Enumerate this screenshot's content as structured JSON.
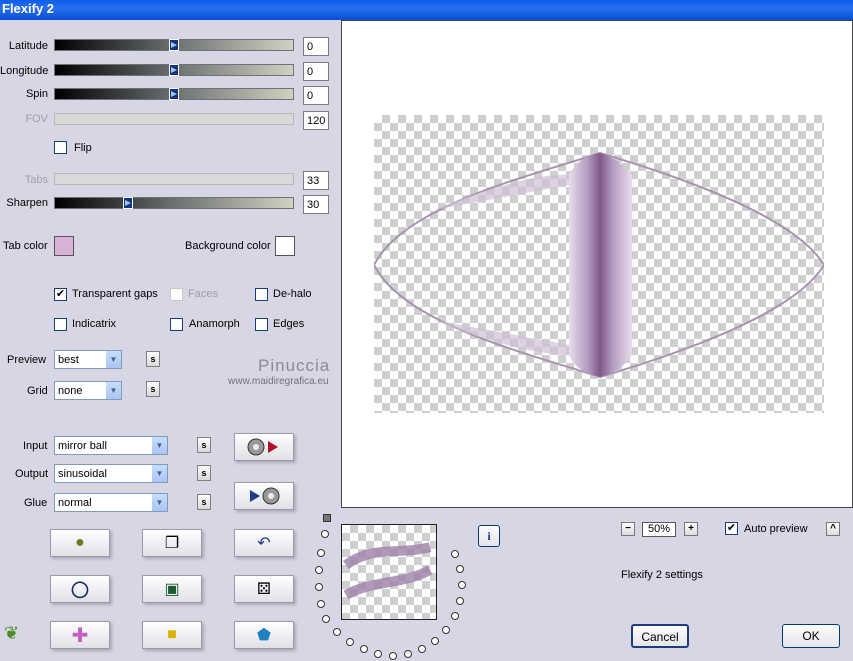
{
  "window": {
    "title": "Flexify 2"
  },
  "sliders": {
    "latitude": {
      "label": "Latitude",
      "value": "0"
    },
    "longitude": {
      "label": "Longitude",
      "value": "0"
    },
    "spin": {
      "label": "Spin",
      "value": "0"
    },
    "fov": {
      "label": "FOV",
      "value": "120"
    },
    "tabs": {
      "label": "Tabs",
      "value": "33"
    },
    "sharpen": {
      "label": "Sharpen",
      "value": "30"
    }
  },
  "flip": {
    "label": "Flip",
    "checked": false
  },
  "colors": {
    "tab_color_label": "Tab color",
    "tab_color": "#d8b0d8",
    "background_color_label": "Background color",
    "background_color": "#ffffff"
  },
  "options": {
    "transparent_gaps": {
      "label": "Transparent gaps",
      "checked": true
    },
    "faces": {
      "label": "Faces",
      "checked": false
    },
    "de_halo": {
      "label": "De-halo",
      "checked": false
    },
    "indicatrix": {
      "label": "Indicatrix",
      "checked": false
    },
    "anamorph": {
      "label": "Anamorph",
      "checked": false
    },
    "edges": {
      "label": "Edges",
      "checked": false
    }
  },
  "preview": {
    "label": "Preview",
    "value": "best"
  },
  "grid": {
    "label": "Grid",
    "value": "none"
  },
  "watermark": {
    "name": "Pinuccia",
    "url": "www.maidiregrafica.eu"
  },
  "input": {
    "label": "Input",
    "value": "mirror ball"
  },
  "output": {
    "label": "Output",
    "value": "sinusoidal"
  },
  "glue": {
    "label": "Glue",
    "value": "normal"
  },
  "s_label": "s",
  "zoom": {
    "value": "50%",
    "minus": "−",
    "plus": "+"
  },
  "auto_preview": {
    "label": "Auto preview",
    "checked": true
  },
  "collapse_label": "^",
  "info_label": "i",
  "settings_name": "Flexify 2 settings",
  "cancel_label": "Cancel",
  "ok_label": "OK"
}
